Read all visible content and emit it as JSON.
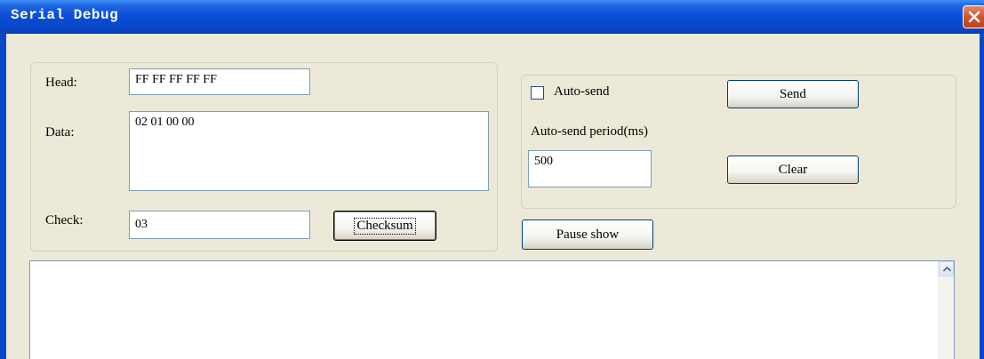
{
  "window": {
    "title": "Serial Debug"
  },
  "data_group": {
    "head_label": "Head:",
    "head_value": "FF FF FF FF FF",
    "data_label": "Data:",
    "data_value": "02 01 00 00",
    "check_label": "Check:",
    "check_value": "03",
    "checksum_button": "Checksum"
  },
  "send_group": {
    "auto_send_label": "Auto-send",
    "auto_send_checked": false,
    "send_button": "Send",
    "period_label": "Auto-send period(ms)",
    "period_value": "500",
    "clear_button": "Clear"
  },
  "pause_button": "Pause show",
  "log": {
    "content": ""
  },
  "icons": {
    "close": "close-icon",
    "checkbox": "checkbox-icon",
    "scroll_up": "chevron-up-icon"
  },
  "colors": {
    "titlebar": "#0a4fd8",
    "client_background": "#ece9d8",
    "close_button": "#d2532f"
  }
}
